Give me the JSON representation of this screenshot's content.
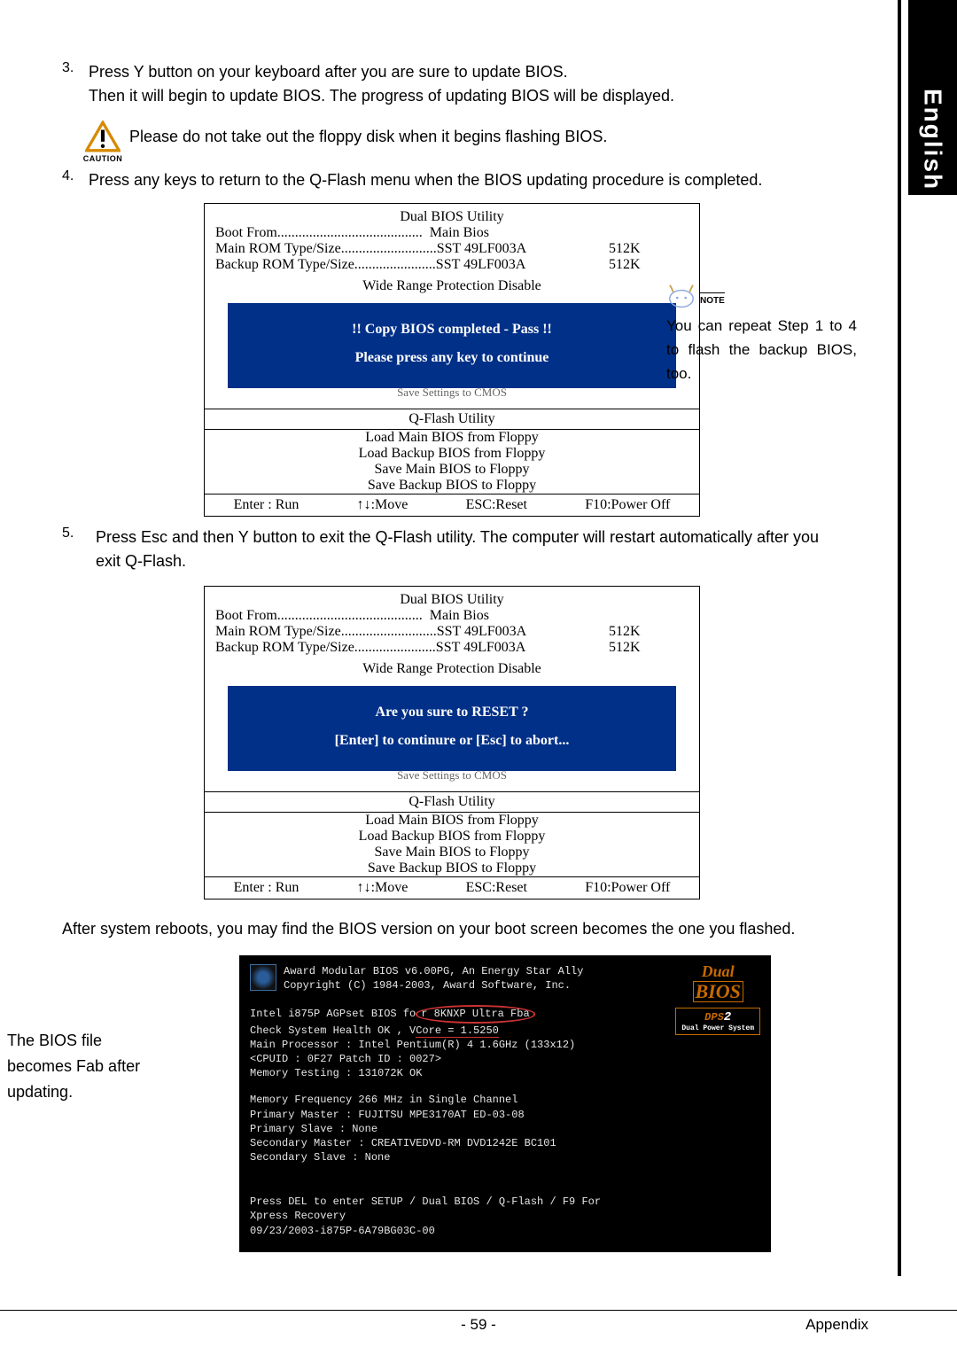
{
  "sidebar": {
    "lang": "English"
  },
  "steps": {
    "s3_num": "3.",
    "s3_line1": "Press Y button on your keyboard after you are sure to update BIOS.",
    "s3_line2": "Then it will begin to update BIOS. The progress of updating BIOS will be displayed.",
    "caution_label": "CAUTION",
    "caution_text": "Please do not take out the floppy disk when it begins flashing BIOS.",
    "s4_num": "4.",
    "s4_text": "Press any keys to return to the Q-Flash menu when the BIOS updating procedure is completed.",
    "s5_num": "5.",
    "s5_text": "Press Esc and then Y button to exit the Q-Flash utility. The computer will restart automatically after you exit Q-Flash.",
    "after_reboot": "After system reboots, you may find the BIOS version on your boot screen becomes the one you flashed."
  },
  "note": {
    "label": "NOTE",
    "text": "You can repeat Step 1 to 4 to flash the backup BIOS, too."
  },
  "bios1": {
    "title": "Dual BIOS Utility",
    "boot_from_lbl": "Boot From.........................................",
    "boot_from_val": "Main Bios",
    "main_rom_lbl": "Main ROM Type/Size...........................",
    "main_rom_val": "SST 49LF003A",
    "main_rom_size": "512K",
    "bak_rom_lbl": "Backup ROM Type/Size.......................",
    "bak_rom_val": "SST 49LF003A",
    "bak_rom_size": "512K",
    "wrp": "Wide Range Protection    Disable",
    "alert_l1": "!! Copy BIOS completed - Pass !!",
    "alert_l2": "Please press any key to continue",
    "underbar": "Save Settings to CMOS",
    "qflash": "Q-Flash Utility",
    "m1": "Load Main BIOS from Floppy",
    "m2": "Load Backup BIOS from Floppy",
    "m3": "Save Main BIOS to Floppy",
    "m4": "Save Backup BIOS to Floppy",
    "k1": "Enter : Run",
    "k2": "↑↓:Move",
    "k3": "ESC:Reset",
    "k4": "F10:Power Off"
  },
  "bios2": {
    "title": "Dual BIOS Utility",
    "boot_from_lbl": "Boot From.........................................",
    "boot_from_val": "Main Bios",
    "main_rom_lbl": "Main ROM Type/Size...........................",
    "main_rom_val": "SST 49LF003A",
    "main_rom_size": "512K",
    "bak_rom_lbl": "Backup ROM Type/Size.......................",
    "bak_rom_val": "SST 49LF003A",
    "bak_rom_size": "512K",
    "wrp": "Wide Range Protection    Disable",
    "alert_l1": "Are you sure to RESET ?",
    "alert_l2": "[Enter] to continure or [Esc] to abort...",
    "underbar": "Save Settings to CMOS",
    "qflash": "Q-Flash Utility",
    "m1": "Load Main BIOS from Floppy",
    "m2": "Load Backup BIOS from Floppy",
    "m3": "Save Main BIOS to Floppy",
    "m4": "Save Backup BIOS to Floppy",
    "k1": "Enter : Run",
    "k2": "↑↓:Move",
    "k3": "ESC:Reset",
    "k4": "F10:Power Off"
  },
  "post": {
    "hdr1": "Award Modular BIOS v6.00PG, An Energy Star Ally",
    "hdr2": "Copyright  (C) 1984-2003, Award Software,  Inc.",
    "dual_l1": "Dual",
    "dual_l2": "BIOS",
    "dps": "DPS",
    "dps_sub": "Dual Power System",
    "l1a": "Intel i875P AGPset BIOS fo",
    "l1b": "r 8KNXP Ultra Fba",
    "l2a": "Check System Health OK , V",
    "l2b": "Core = 1.5250",
    "l3": "Main Processor :  Intel Pentium(R) 4  1.6GHz (133x12)",
    "l4": "<CPUID : 0F27 Patch ID  : 0027>",
    "l5": "Memory Testing  : 131072K OK",
    "l6": "Memory Frequency 266 MHz in Single Channel",
    "l7": "Primary Master : FUJITSU MPE3170AT ED-03-08",
    "l8": "Primary Slave : None",
    "l9": "Secondary Master :  CREATIVEDVD-RM DVD1242E BC101",
    "l10": "Secondary Slave : None",
    "l11": "Press DEL to enter SETUP / Dual BIOS / Q-Flash / F9 For",
    "l12": "Xpress Recovery",
    "l13": "09/23/2003-i875P-6A79BG03C-00"
  },
  "callout": "The BIOS file becomes Fab after updating.",
  "footer": {
    "page": "- 59 -",
    "section": "Appendix"
  }
}
